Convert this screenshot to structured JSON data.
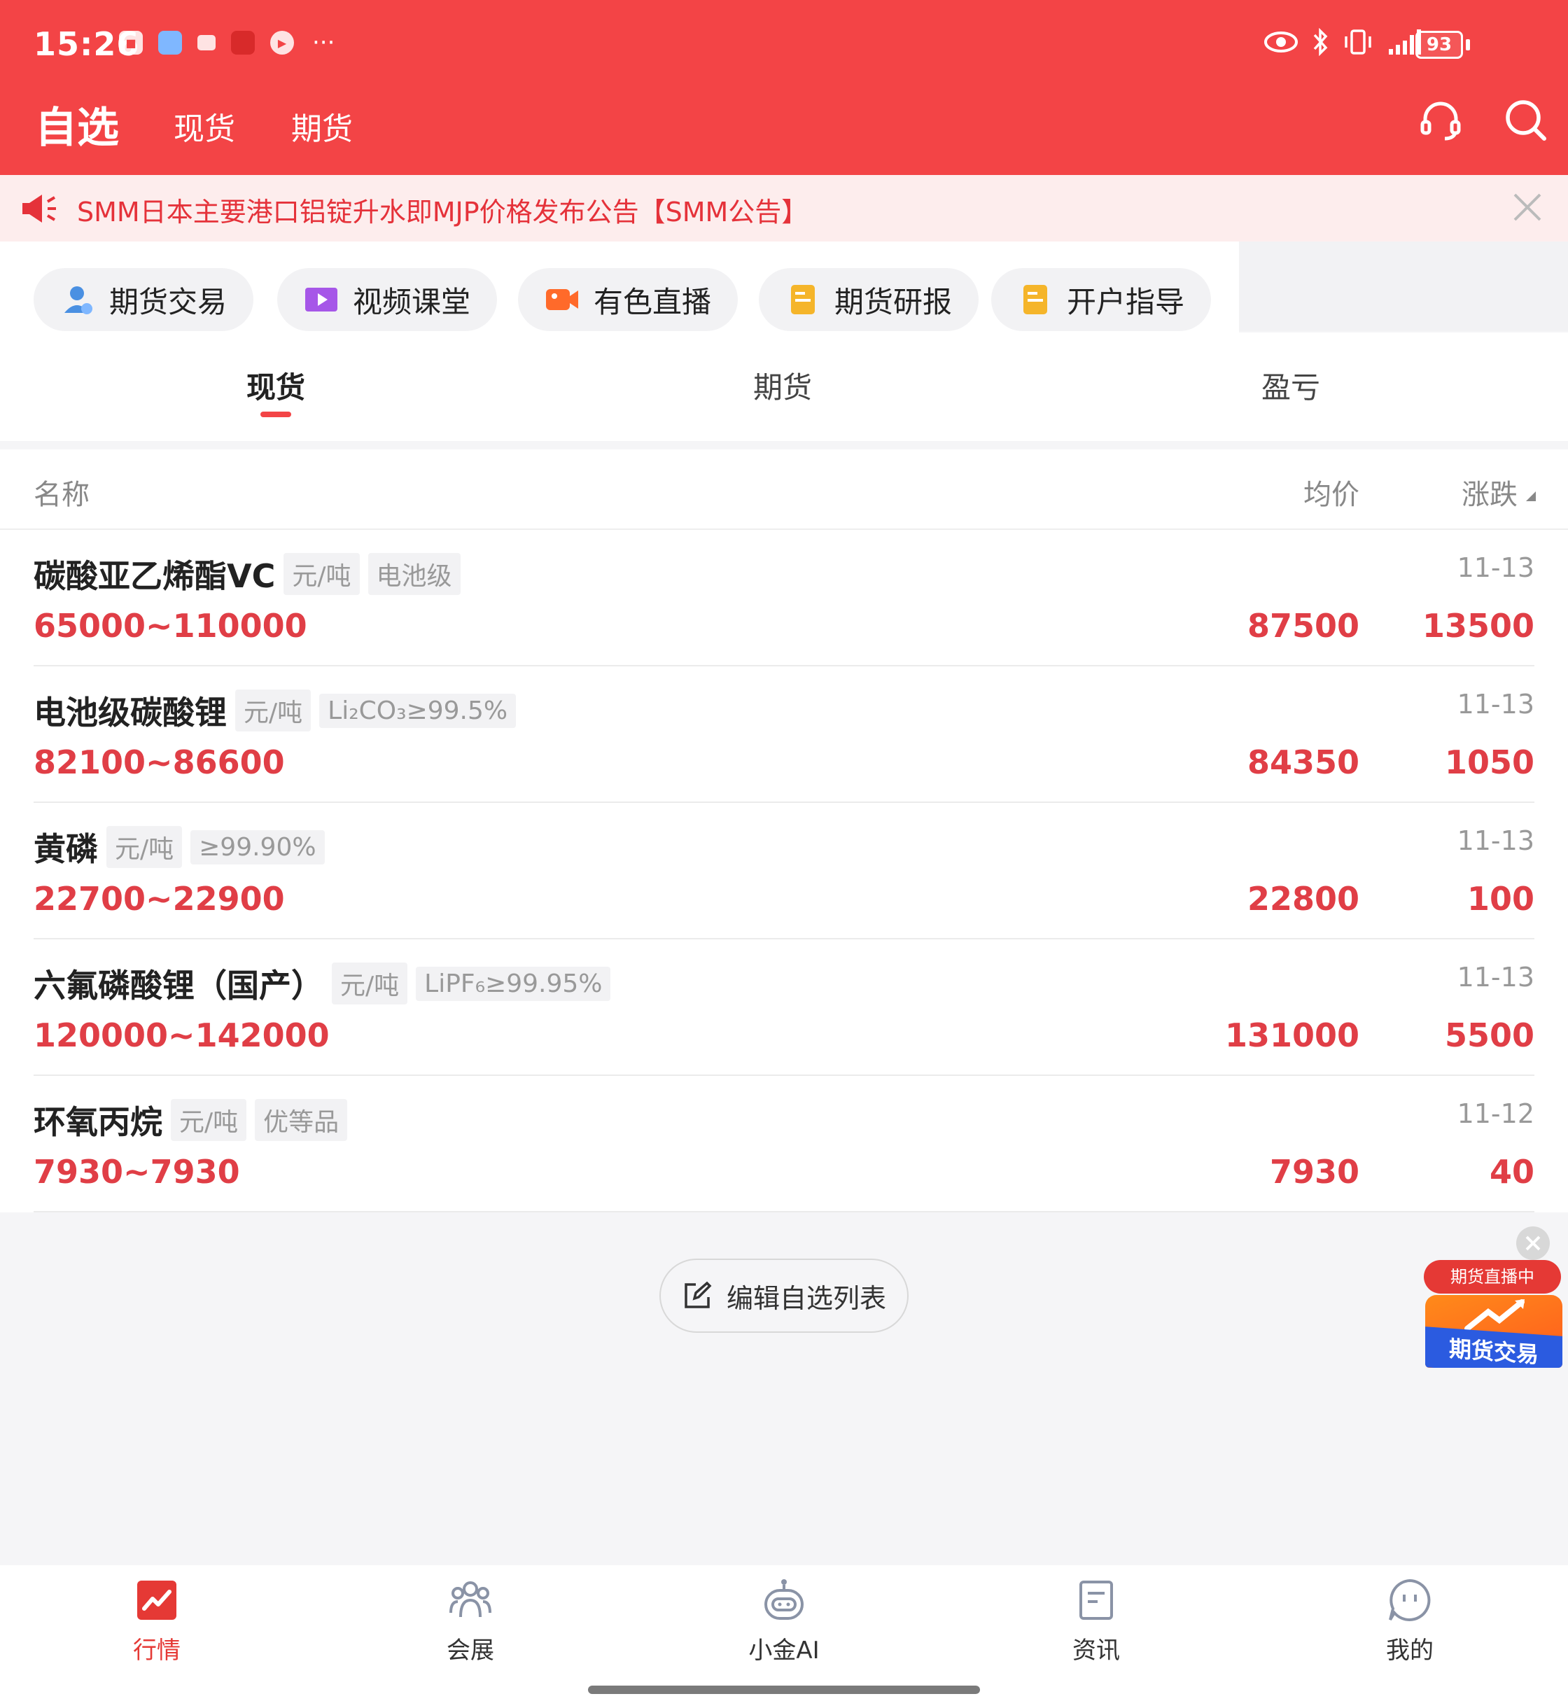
{
  "status": {
    "time": "15:26",
    "more": "···",
    "battery": "93"
  },
  "header": {
    "title": "自选",
    "tabs": [
      "现货",
      "期货"
    ]
  },
  "notice": {
    "text": "SMM日本主要港口铝锭升水即MJP价格发布公告【SMM公告】"
  },
  "shortcuts": [
    {
      "label": "期货交易",
      "color": "#4a90e2"
    },
    {
      "label": "视频课堂",
      "color": "#a657e8"
    },
    {
      "label": "有色直播",
      "color": "#ff6a2a"
    },
    {
      "label": "期货研报",
      "color": "#f5b52a"
    },
    {
      "label": "开户指导",
      "color": "#f5b52a"
    }
  ],
  "segments": [
    "现货",
    "期货",
    "盈亏"
  ],
  "list_header": {
    "name": "名称",
    "avg": "均价",
    "change": "涨跌"
  },
  "rows": [
    {
      "name": "碳酸亚乙烯酯VC",
      "unit": "元/吨",
      "spec": "电池级",
      "date": "11-13",
      "range": "65000~110000",
      "avg": "87500",
      "change": "13500"
    },
    {
      "name": "电池级碳酸锂",
      "unit": "元/吨",
      "spec": "Li₂CO₃≥99.5%",
      "date": "11-13",
      "range": "82100~86600",
      "avg": "84350",
      "change": "1050"
    },
    {
      "name": "黄磷",
      "unit": "元/吨",
      "spec": "≥99.90%",
      "date": "11-13",
      "range": "22700~22900",
      "avg": "22800",
      "change": "100"
    },
    {
      "name": "六氟磷酸锂（国产）",
      "unit": "元/吨",
      "spec": "LiPF₆≥99.95%",
      "date": "11-13",
      "range": "120000~142000",
      "avg": "131000",
      "change": "5500"
    },
    {
      "name": "环氧丙烷",
      "unit": "元/吨",
      "spec": "优等品",
      "date": "11-12",
      "range": "7930~7930",
      "avg": "7930",
      "change": "40"
    }
  ],
  "edit_button": "编辑自选列表",
  "float_ad": {
    "live": "期货直播中",
    "banner": "期货交易"
  },
  "bottom_nav": [
    "行情",
    "会展",
    "小金AI",
    "资讯",
    "我的"
  ],
  "colors": {
    "brand": "#f34446",
    "price": "#e03e46"
  }
}
